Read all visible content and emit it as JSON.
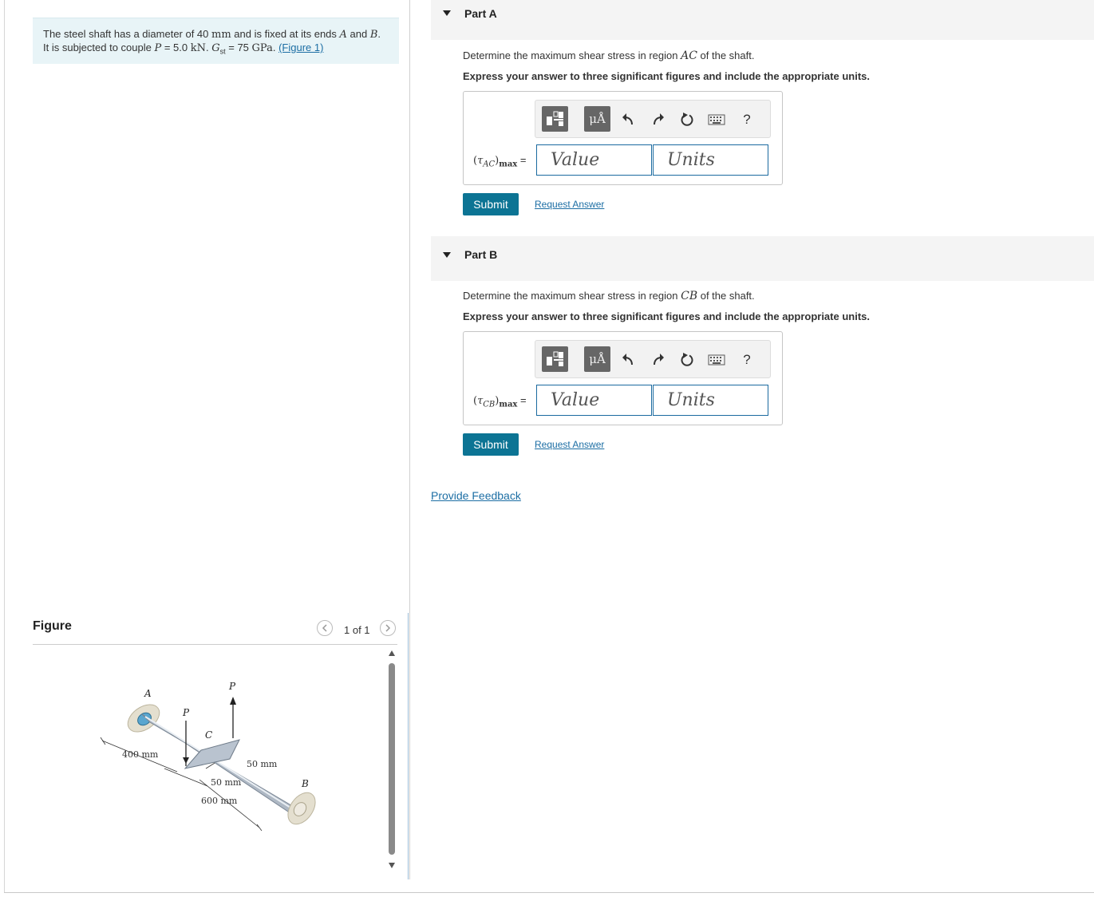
{
  "problem": {
    "t1": "The steel shaft has a diameter of 40 ",
    "mm": "mm",
    "t2": " and is fixed at its ends ",
    "A": "A",
    "t3": " and ",
    "B": "B",
    "t4": ".",
    "t5": "It is subjected to couple ",
    "P": "P",
    "t6": " = 5.0 ",
    "kN": "kN",
    "t7": ". ",
    "G": "G",
    "Gsub": "st",
    "t8": " = 75 ",
    "GPa": "GPa",
    "t9": ". ",
    "figure_link": "(Figure 1)"
  },
  "figure": {
    "title": "Figure",
    "count": "1 of 1",
    "prev_icon": "chevron-left-icon",
    "next_icon": "chevron-right-icon",
    "labels": {
      "A": "A",
      "B": "B",
      "C": "C",
      "P1": "P",
      "P2": "P",
      "d400": "400 mm",
      "d50a": "50 mm",
      "d50b": "50 mm",
      "d600": "600 mm"
    }
  },
  "partA": {
    "title": "Part A",
    "prompt_pre": "Determine the maximum shear stress in region ",
    "region": "AC",
    "prompt_post": " of the shaft.",
    "instruction": "Express your answer to three significant figures and include the appropriate units.",
    "tau": "τ",
    "sub": "AC",
    "max": "max",
    "eq": " =",
    "value_placeholder": "Value",
    "units_placeholder": "Units",
    "submit": "Submit",
    "request": "Request Answer"
  },
  "partB": {
    "title": "Part B",
    "prompt_pre": "Determine the maximum shear stress in region ",
    "region": "CB",
    "prompt_post": " of the shaft.",
    "instruction": "Express your answer to three significant figures and include the appropriate units.",
    "tau": "τ",
    "sub": "CB",
    "max": "max",
    "eq": " =",
    "value_placeholder": "Value",
    "units_placeholder": "Units",
    "submit": "Submit",
    "request": "Request Answer"
  },
  "toolbar": {
    "units_glyph": "μÅ",
    "help": "?",
    "icons": [
      "templates-icon",
      "units-icon",
      "undo-icon",
      "redo-icon",
      "reset-icon",
      "keyboard-icon",
      "help-icon"
    ]
  },
  "feedback": "Provide Feedback"
}
